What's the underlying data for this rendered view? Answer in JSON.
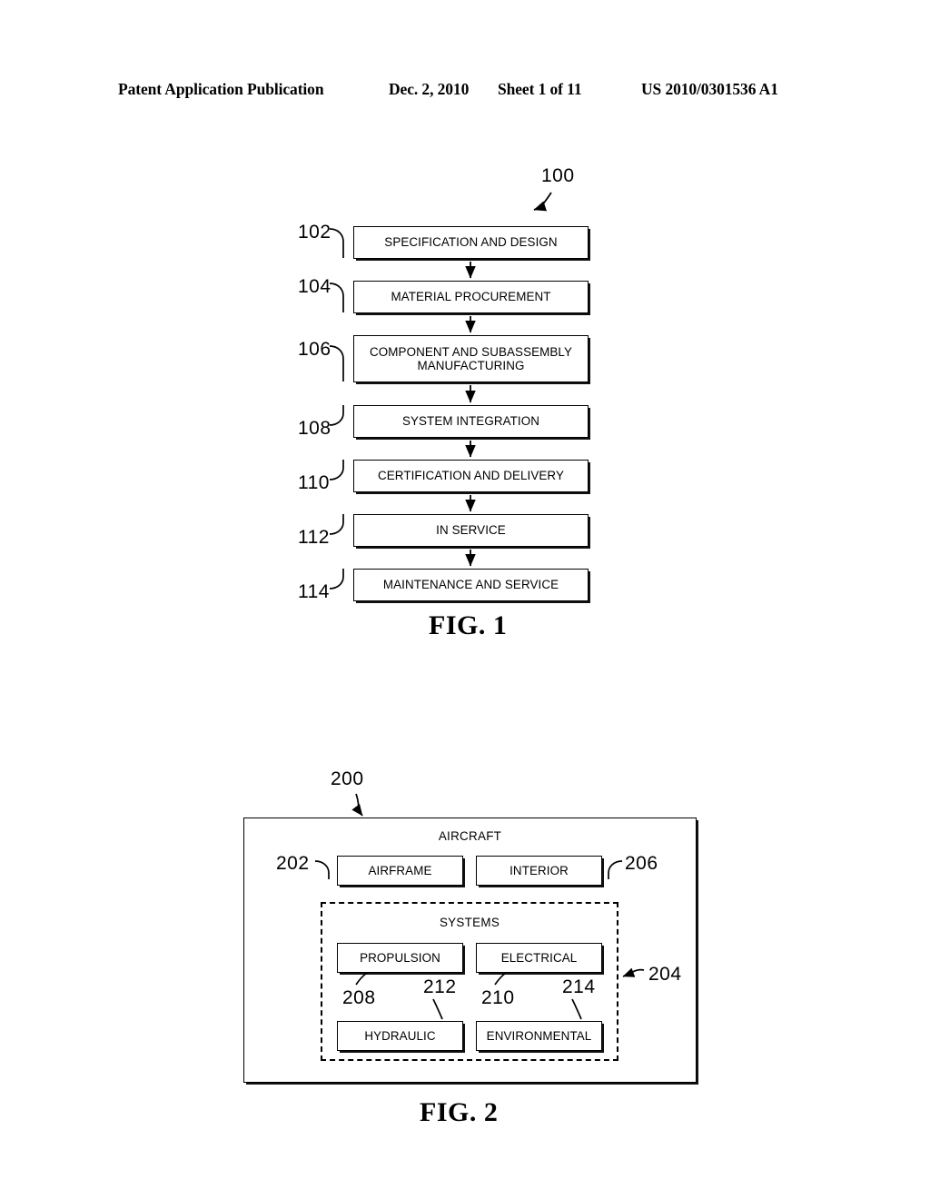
{
  "header": {
    "publication": "Patent Application Publication",
    "date": "Dec. 2, 2010",
    "sheet": "Sheet 1 of 11",
    "patent_number": "US 2010/0301536 A1"
  },
  "figure1": {
    "caption": "FIG. 1",
    "diagram_ref": "100",
    "steps": [
      {
        "ref": "102",
        "label": "SPECIFICATION AND DESIGN"
      },
      {
        "ref": "104",
        "label": "MATERIAL PROCUREMENT"
      },
      {
        "ref": "106",
        "label": "COMPONENT AND SUBASSEMBLY\nMANUFACTURING"
      },
      {
        "ref": "108",
        "label": "SYSTEM INTEGRATION"
      },
      {
        "ref": "110",
        "label": "CERTIFICATION AND DELIVERY"
      },
      {
        "ref": "112",
        "label": "IN SERVICE"
      },
      {
        "ref": "114",
        "label": "MAINTENANCE AND SERVICE"
      }
    ]
  },
  "figure2": {
    "caption": "FIG. 2",
    "diagram_ref": "200",
    "aircraft_title": "AIRCRAFT",
    "systems_title": "SYSTEMS",
    "systems_ref": "204",
    "top_boxes": [
      {
        "ref": "202",
        "label": "AIRFRAME"
      },
      {
        "ref": "206",
        "label": "INTERIOR"
      }
    ],
    "system_boxes": [
      {
        "ref": "208",
        "label": "PROPULSION"
      },
      {
        "ref": "210",
        "label": "ELECTRICAL"
      },
      {
        "ref": "212",
        "label": "HYDRAULIC"
      },
      {
        "ref": "214",
        "label": "ENVIRONMENTAL"
      }
    ]
  }
}
